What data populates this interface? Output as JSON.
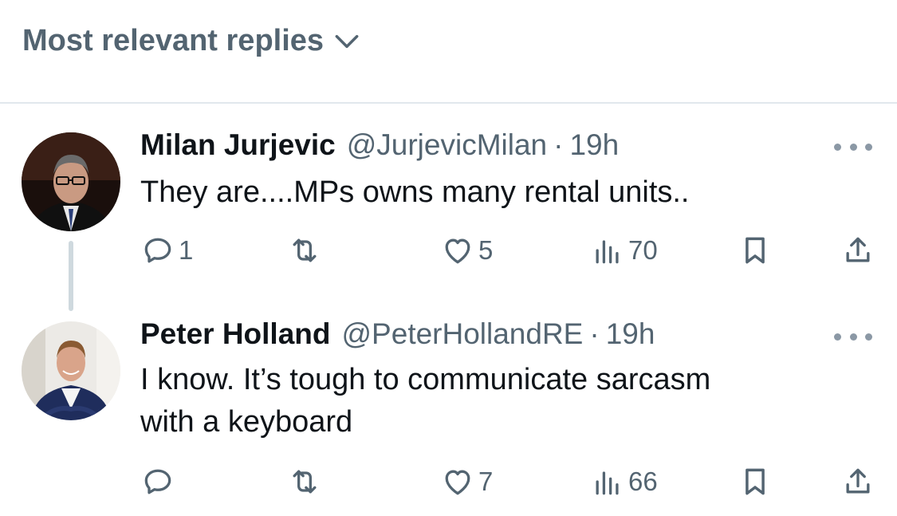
{
  "sort": {
    "label": "Most relevant replies"
  },
  "replies": [
    {
      "name": "Milan Jurjevic",
      "handle": "@JurjevicMilan",
      "dot": "·",
      "time": "19h",
      "text": "They are....MPs owns many rental units..",
      "reply_count": "1",
      "retweet_count": "",
      "like_count": "5",
      "view_count": "70"
    },
    {
      "name": "Peter Holland",
      "handle": "@PeterHollandRE",
      "dot": "·",
      "time": "19h",
      "text_line1": "I know. It’s tough to communicate sarcasm",
      "text_line2": "with a keyboard",
      "reply_count": "",
      "retweet_count": "",
      "like_count": "7",
      "view_count": "66"
    }
  ],
  "icons": {
    "sort": "chevron-down-icon",
    "reply": "speech-bubble-icon",
    "retweet": "retweet-icon",
    "like": "heart-icon",
    "views": "bar-chart-icon",
    "bookmark": "bookmark-icon",
    "share": "share-icon",
    "more": "ellipsis-icon"
  },
  "colors": {
    "secondary_text": "#536471",
    "primary_text": "#0f1419",
    "divider": "#e1e8ed"
  }
}
